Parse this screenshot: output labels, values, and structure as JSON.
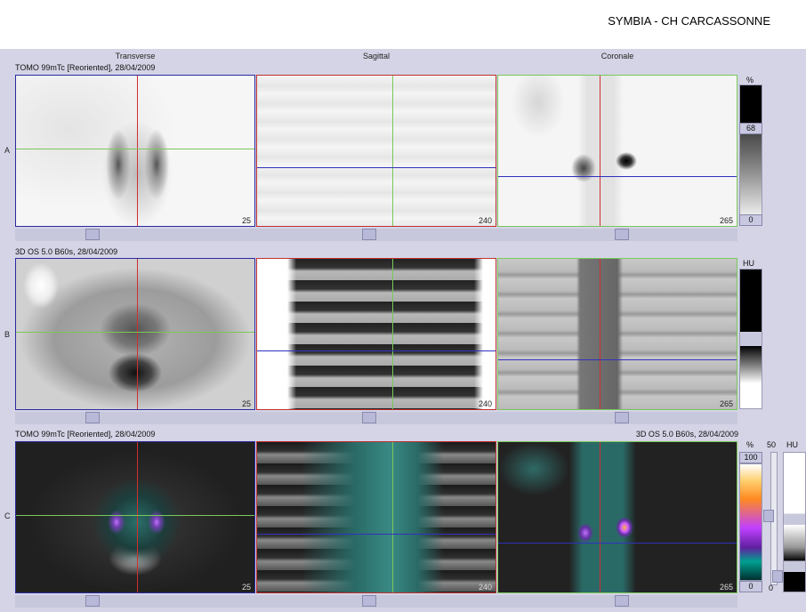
{
  "header": {
    "title": "SYMBIA - CH CARCASSONNE"
  },
  "columns": {
    "transverse": "Transverse",
    "sagittal": "Sagittal",
    "coronal": "Coronale"
  },
  "rows": {
    "a": {
      "label": "A",
      "series": "TOMO 99mTc [Reoriented], 28/04/2009",
      "colorbar_unit": "%",
      "colorbar_max": "68",
      "colorbar_min": "0"
    },
    "b": {
      "label": "B",
      "series": "3D  OS  5.0  B60s, 28/04/2009",
      "colorbar_unit": "HU"
    },
    "c": {
      "label": "C",
      "series_left": "TOMO 99mTc [Reoriented], 28/04/2009",
      "series_right": "3D  OS  5.0  B60s, 28/04/2009",
      "colorbar_unit": "%",
      "colorbar_max": "100",
      "colorbar_min": "0",
      "blend_max": "50",
      "blend_min": "0",
      "ct_unit": "HU"
    }
  },
  "slices": {
    "transverse": "25",
    "sagittal": "240",
    "coronal": "265"
  },
  "colors": {
    "transverse_frame": "#2a2aa0",
    "sagittal_frame": "#c03030",
    "coronal_frame": "#7ac85a",
    "crosshair_red": "#d03030",
    "crosshair_green": "#7ac85a",
    "crosshair_blue": "#3030c0"
  }
}
